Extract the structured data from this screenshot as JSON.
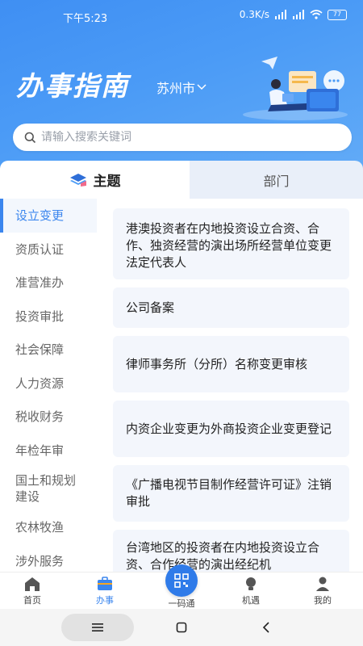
{
  "status": {
    "time": "下午5:23",
    "net_speed": "0.3K/s",
    "battery": "77"
  },
  "header": {
    "title": "办事指南",
    "city": "苏州市"
  },
  "search": {
    "placeholder": "请输入搜索关键词"
  },
  "tabs": [
    {
      "label": "主题"
    },
    {
      "label": "部门"
    }
  ],
  "sidebar": {
    "items": [
      {
        "label": "设立变更"
      },
      {
        "label": "资质认证"
      },
      {
        "label": "准营准办"
      },
      {
        "label": "投资审批"
      },
      {
        "label": "社会保障"
      },
      {
        "label": "人力资源"
      },
      {
        "label": "税收财务"
      },
      {
        "label": "年检年审"
      },
      {
        "label": "国土和规划建设"
      },
      {
        "label": "农林牧渔"
      },
      {
        "label": "涉外服务"
      }
    ]
  },
  "list": {
    "items": [
      {
        "text": "港澳投资者在内地投资设立合资、合作、独资经营的演出场所经营单位变更法定代表人"
      },
      {
        "text": "公司备案"
      },
      {
        "text": "律师事务所（分所）名称变更审核"
      },
      {
        "text": "内资企业变更为外商投资企业变更登记"
      },
      {
        "text": "《广播电视节目制作经营许可证》注销审批"
      },
      {
        "text": "台湾地区的投资者在内地投资设立合资、合作经营的演出经纪机"
      }
    ]
  },
  "bottom_nav": [
    {
      "label": "首页",
      "icon": "home-icon"
    },
    {
      "label": "办事",
      "icon": "briefcase-icon"
    },
    {
      "label": "一码通",
      "icon": "qr-code-icon"
    },
    {
      "label": "机遇",
      "icon": "lightbulb-icon"
    },
    {
      "label": "我的",
      "icon": "user-icon"
    }
  ],
  "colors": {
    "accent": "#3b86ee",
    "header": "#4b9bf6"
  }
}
